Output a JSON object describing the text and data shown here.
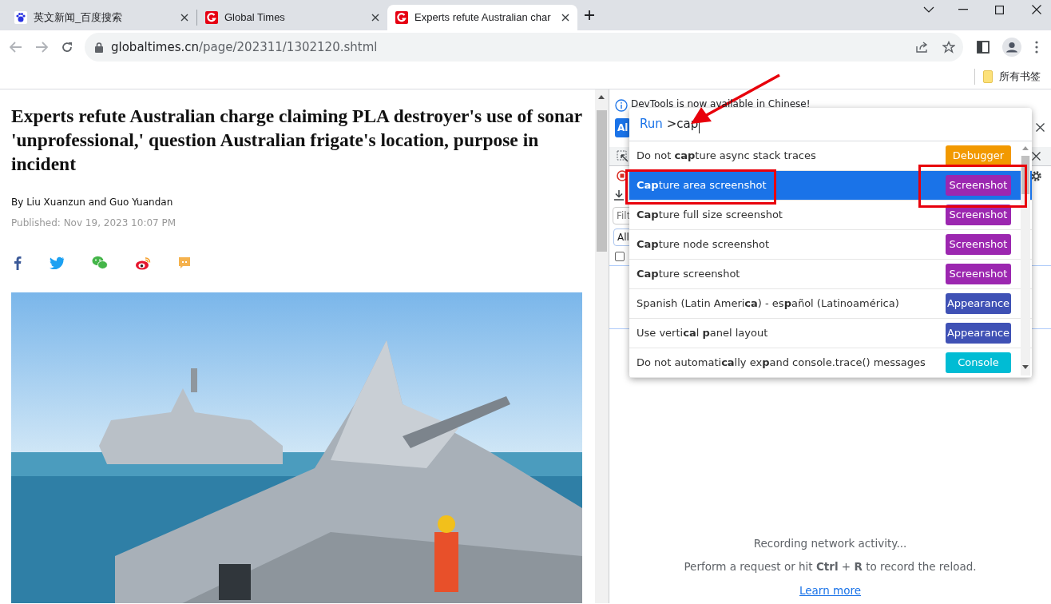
{
  "tabs": [
    {
      "title": "英文新闻_百度搜索",
      "kind": "paw",
      "selected": false
    },
    {
      "title": "Global Times",
      "kind": "g",
      "selected": false
    },
    {
      "title": "Experts refute Australian char",
      "kind": "g",
      "selected": true
    }
  ],
  "address": {
    "host": "globaltimes.cn",
    "path": "/page/202311/1302120.shtml"
  },
  "bookmarks": {
    "folder": "所有书签"
  },
  "article": {
    "headline": "Experts refute Australian charge claiming PLA destroyer's use of sonar 'unprofessional,' question Australian frigate's location, purpose in incident",
    "byline": "By Liu Xuanzun and Guo Yuandan",
    "published": "Published: Nov 19, 2023 10:07 PM"
  },
  "devtools": {
    "infobar": "DevTools is now available in Chinese!",
    "button_fragment": "Al",
    "filter": {
      "placeholder": "Filt"
    },
    "chip": "All",
    "checkbox": {
      "checked": false
    },
    "empty_state": {
      "title": "Recording network activity...",
      "hint": "Perform a request or hit **Ctrl** + **R** to record the reload.",
      "link": "Learn more"
    }
  },
  "command_menu": {
    "prefix": "Run",
    "query": ">cap",
    "items": [
      {
        "label": "Do not **cap**ture async stack traces",
        "category": "Debugger",
        "color": "#f29900",
        "selected": false
      },
      {
        "label": "**Cap**ture area screenshot",
        "category": "Screenshot",
        "color": "#9c27b0",
        "selected": true
      },
      {
        "label": "**Cap**ture full size screenshot",
        "category": "Screenshot",
        "color": "#9c27b0",
        "selected": false
      },
      {
        "label": "**Cap**ture node screenshot",
        "category": "Screenshot",
        "color": "#9c27b0",
        "selected": false
      },
      {
        "label": "**Cap**ture screenshot",
        "category": "Screenshot",
        "color": "#9c27b0",
        "selected": false
      },
      {
        "label": "Spanish (Latin Ameri**ca**) - es**p**añol (Latinoamérica)",
        "category": "Appearance",
        "color": "#3f51b5",
        "selected": false
      },
      {
        "label": "Use verti**ca**l **p**anel layout",
        "category": "Appearance",
        "color": "#3f51b5",
        "selected": false
      },
      {
        "label": "Do not automati**ca**lly ex**p**and console.trace() messages",
        "category": "Console",
        "color": "#00bcd4",
        "selected": false
      }
    ]
  }
}
